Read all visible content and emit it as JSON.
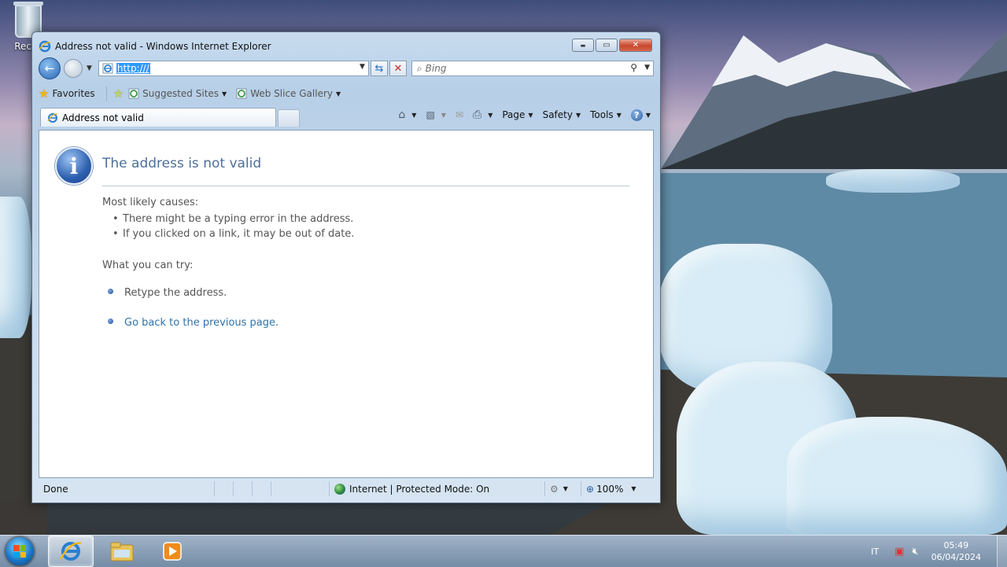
{
  "desktop": {
    "recycle_label": "Recyc"
  },
  "window": {
    "title": "Address not valid - Windows Internet Explorer",
    "caption": {
      "minimize": "▬",
      "maximize": "▭",
      "close": "✕"
    }
  },
  "navbar": {
    "address_value": "http:///",
    "search_placeholder": "Bing"
  },
  "favorites_bar": {
    "favorites_label": "Favorites",
    "items": [
      "Suggested Sites",
      "Web Slice Gallery"
    ]
  },
  "tab": {
    "label": "Address not valid"
  },
  "command_bar": {
    "page_label": "Page",
    "safety_label": "Safety",
    "tools_label": "Tools"
  },
  "page": {
    "heading": "The address is not valid",
    "causes_title": "Most likely causes:",
    "causes": [
      "There might be a typing error in the address.",
      "If you clicked on a link, it may be out of date."
    ],
    "try_title": "What you can try:",
    "try_items": [
      {
        "text": "Retype the address.",
        "link": false
      },
      {
        "text": "Go back to the previous page.",
        "link": true
      }
    ]
  },
  "status_bar": {
    "status": "Done",
    "zone": "Internet | Protected Mode: On",
    "zoom": "100%"
  },
  "taskbar": {
    "language": "IT",
    "time": "05:49",
    "date": "06/04/2024"
  },
  "colors": {
    "link": "#2f72a9",
    "heading": "#4e6f9a",
    "selection": "#3399ff"
  }
}
